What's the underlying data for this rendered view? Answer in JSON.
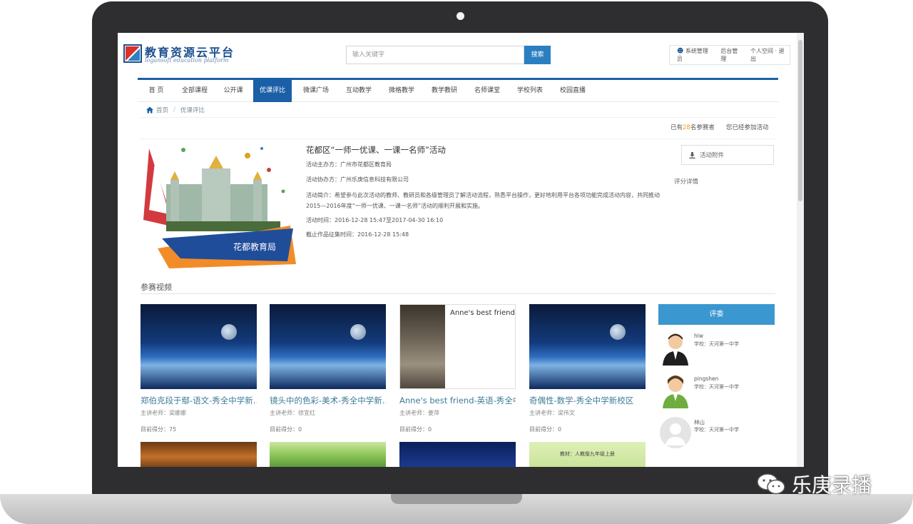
{
  "header": {
    "logo_title": "教育资源云平台",
    "logo_subtitle": "logansoft education platform",
    "search_placeholder": "输入关键字",
    "search_button": "搜索",
    "user_name": "系统管理员",
    "admin_link": "后台管理",
    "space_link": "个人空间",
    "logout_link": "退出"
  },
  "nav": {
    "items": [
      "首 页",
      "全部课程",
      "公开课",
      "优课评比",
      "微课广场",
      "互动教学",
      "微格教学",
      "教学教研",
      "名师课堂",
      "学校列表",
      "校园直播"
    ],
    "active_index": 3
  },
  "breadcrumb": {
    "home": "首页",
    "separator": "/",
    "current": "优课评比"
  },
  "stats": {
    "prefix": "已有",
    "count": "28",
    "suffix": "名参赛者",
    "joined": "您已经参加活动"
  },
  "activity": {
    "banner_text": "花都教育局",
    "title": "花都区“一师一优课、一课一名师”活动",
    "organizer": "活动主办方：广州市花都区教育局",
    "co_organizer": "活动协办方：广州乐庚信息科技有限公司",
    "intro": "活动简介：希望参与此次活动的教师、教研员和各级管理员了解活动流程，熟悉平台操作，更好地利用平台各项功能完成活动内容，共同推动2015—2016年度“一师一优课、一课一名师”活动的顺利开展和实施。",
    "time": "活动时间：2016-12-28 15:47至2017-04-30 16:10",
    "deadline": "截止作品征集时间：2016-12-28 15:48",
    "attachment_button": "活动附件",
    "score_detail": "评分详情"
  },
  "videos": {
    "section_title": "参赛视频",
    "items": [
      {
        "title": "郑伯克段于鄢-语文-秀全中学新...",
        "teacher": "主讲老师：梁娜娜",
        "score": "目前得分：75"
      },
      {
        "title": "镜头中的色彩-美术-秀全中学新...",
        "teacher": "主讲老师：徐宜红",
        "score": "目前得分：0"
      },
      {
        "title": "Anne's best friend-英语-秀全中...",
        "teacher": "主讲老师：姜萍",
        "score": "目前得分：0"
      },
      {
        "title": "奇偶性-数学-秀全中学新校区",
        "teacher": "主讲老师：梁伟文",
        "score": "目前得分：0"
      }
    ],
    "thumb_anne_title": "Anne's best friend",
    "thumb2_last_caption": "教材：人教版九年级上册"
  },
  "judges": {
    "heading": "评委",
    "items": [
      {
        "name": "hlw",
        "school": "学校：天河第一中学"
      },
      {
        "name": "pingshen",
        "school": "学校：天河第一中学"
      },
      {
        "name": "林山",
        "school": "学校：天河第一中学"
      }
    ]
  },
  "watermark": {
    "text": "乐庚录播"
  },
  "colors": {
    "nav_active": "#1b5fa6",
    "judge_header": "#3a97cf",
    "video_title": "#3e7c9a",
    "count_highlight": "#f0a000"
  }
}
